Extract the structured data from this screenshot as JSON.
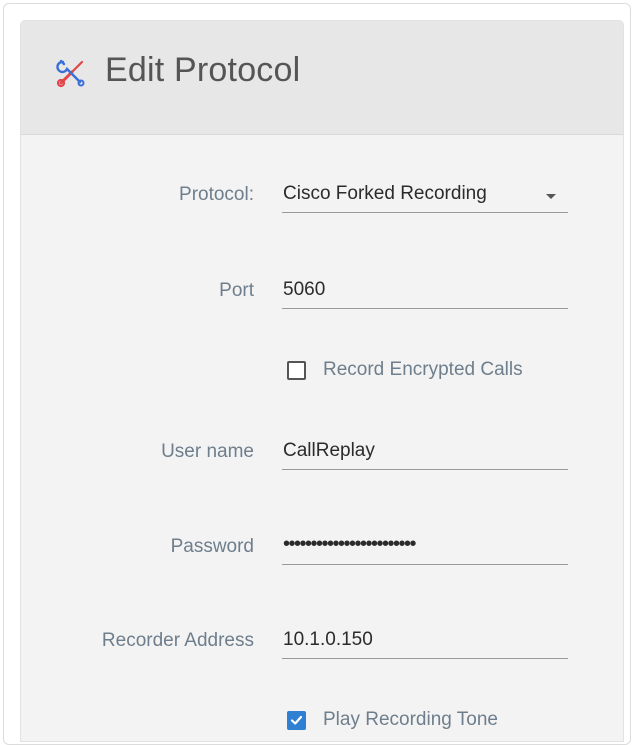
{
  "dialog": {
    "title": "Edit Protocol",
    "icon": "tools-icon"
  },
  "form": {
    "protocol": {
      "label": "Protocol:",
      "value": "Cisco Forked Recording"
    },
    "port": {
      "label": "Port",
      "value": "5060"
    },
    "record_encrypted_calls": {
      "label": "Record Encrypted Calls",
      "checked": false
    },
    "user_name": {
      "label": "User name",
      "value": "CallReplay"
    },
    "password": {
      "label": "Password",
      "masked_value": "••••••••••••••••••••••••"
    },
    "recorder_address": {
      "label": "Recorder Address",
      "value": "10.1.0.150"
    },
    "play_recording_tone": {
      "label": "Play Recording Tone",
      "checked": true
    }
  },
  "colors": {
    "accent": "#2f7fd3",
    "icon_red": "#e0464a",
    "icon_blue": "#3a6fd8"
  }
}
